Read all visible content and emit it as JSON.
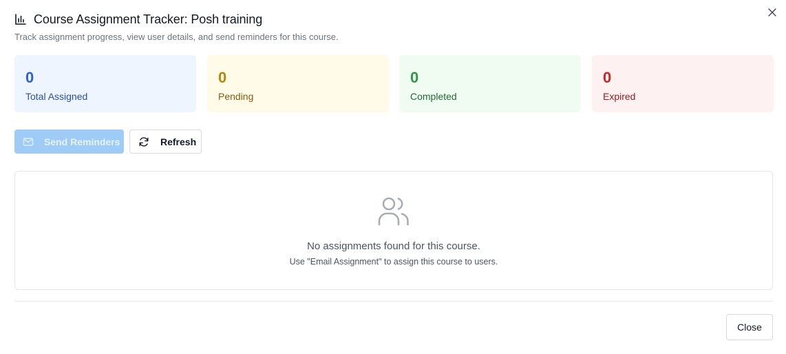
{
  "dialog": {
    "title": "Course Assignment Tracker: Posh training",
    "subtitle": "Track assignment progress, view user details, and send reminders for this course."
  },
  "stats": {
    "total": {
      "value": "0",
      "label": "Total Assigned",
      "color": "#2f5fd6"
    },
    "pending": {
      "value": "0",
      "label": "Pending",
      "color": "#b7860b"
    },
    "completed": {
      "value": "0",
      "label": "Completed",
      "color": "#2f9a45"
    },
    "expired": {
      "value": "0",
      "label": "Expired",
      "color": "#d02424"
    }
  },
  "actions": {
    "send_reminders_label": "Send Reminders",
    "refresh_label": "Refresh"
  },
  "empty_state": {
    "title": "No assignments found for this course.",
    "subtitle": "Use \"Email Assignment\" to assign this course to users.",
    "icon": "users-icon"
  },
  "footer": {
    "close_label": "Close"
  },
  "icons": {
    "title": "bar-chart-icon",
    "close": "close-icon",
    "reminders": "mail-icon",
    "refresh": "refresh-icon"
  }
}
